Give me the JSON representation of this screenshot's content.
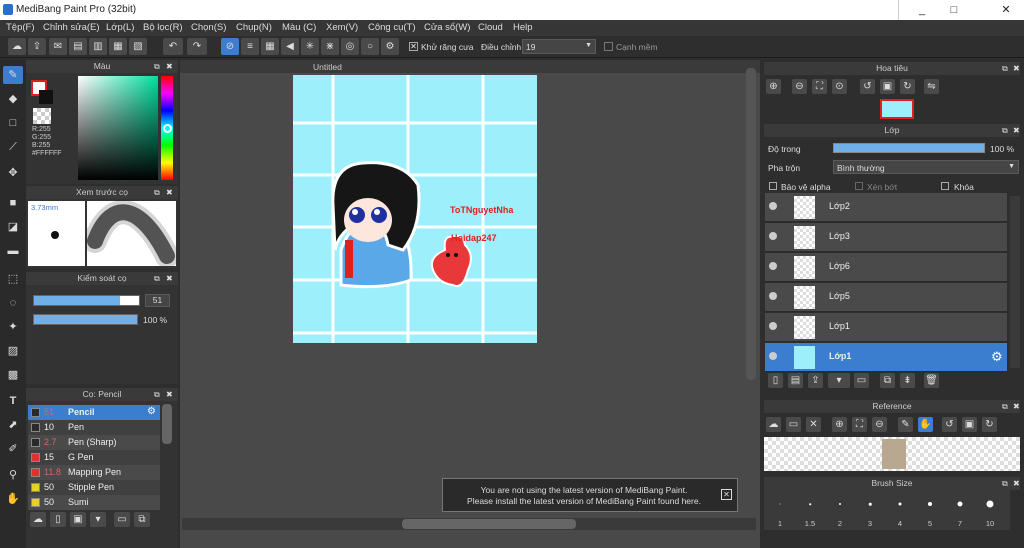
{
  "app": {
    "title": "MediBang Paint Pro (32bit)"
  },
  "menu": [
    "Tệp(F)",
    "Chỉnh sửa(E)",
    "Lớp(L)",
    "Bộ lọc(R)",
    "Chọn(S)",
    "Chụp(N)",
    "Màu (C)",
    "Xem(V)",
    "Công cụ(T)",
    "Cửa sổ(W)",
    "Cloud",
    "Help"
  ],
  "toolbar": {
    "antialias_label": "Khử răng cưa",
    "adjust_label": "Điều chỉnh",
    "adjust_value": "19",
    "edge_label": "Cạnh mềm"
  },
  "color_panel": {
    "title": "Màu",
    "rgb": [
      "R:255",
      "G:255",
      "B:255"
    ],
    "hex": "#FFFFFF"
  },
  "preview_panel": {
    "title": "Xem trước cọ",
    "size": "3.73mm"
  },
  "brush_control": {
    "title": "Kiểm soát cọ",
    "size": "51",
    "opacity": "100 %",
    "size_fill": 0.82,
    "opacity_fill": 1.0
  },
  "brush_list": {
    "title": "Cọ: Pencil",
    "items": [
      {
        "size": "51",
        "name": "Pencil",
        "color": "#2a2a2a",
        "selected": true
      },
      {
        "size": "10",
        "name": "Pen",
        "color": "#2a2a2a"
      },
      {
        "size": "2.7",
        "name": "Pen (Sharp)",
        "color": "#2a2a2a"
      },
      {
        "size": "15",
        "name": "G Pen",
        "color": "#e03030"
      },
      {
        "size": "11.8",
        "name": "Mapping Pen",
        "color": "#e03030"
      },
      {
        "size": "50",
        "name": "Stipple Pen",
        "color": "#e8d020"
      },
      {
        "size": "50",
        "name": "Sumi",
        "color": "#e8d020"
      }
    ]
  },
  "canvas": {
    "tab": "Untitled",
    "sig1": "ToTNguyetNha",
    "sig2": "Hoidap247"
  },
  "navigator": {
    "title": "Hoa tiêu"
  },
  "layer_panel": {
    "title": "Lớp",
    "opacity_label": "Độ trong",
    "opacity_value": "100 %",
    "blend_label": "Pha trộn",
    "blend_value": "Bình thường",
    "protect_alpha": "Bảo vệ alpha",
    "clip": "Xén bớt",
    "lock": "Khóa",
    "layers": [
      "Lớp2",
      "Lớp3",
      "Lớp6",
      "Lớp5",
      "Lớp1",
      "Lớp1"
    ]
  },
  "reference": {
    "title": "Reference"
  },
  "brush_size": {
    "title": "Brush Size",
    "sizes": [
      "1",
      "1.5",
      "2",
      "3",
      "4",
      "5",
      "7",
      "10"
    ]
  },
  "notification": {
    "line1": "You are not using the latest version of MediBang Paint.",
    "line2": "Please install the latest version of MediBang Paint found here."
  }
}
